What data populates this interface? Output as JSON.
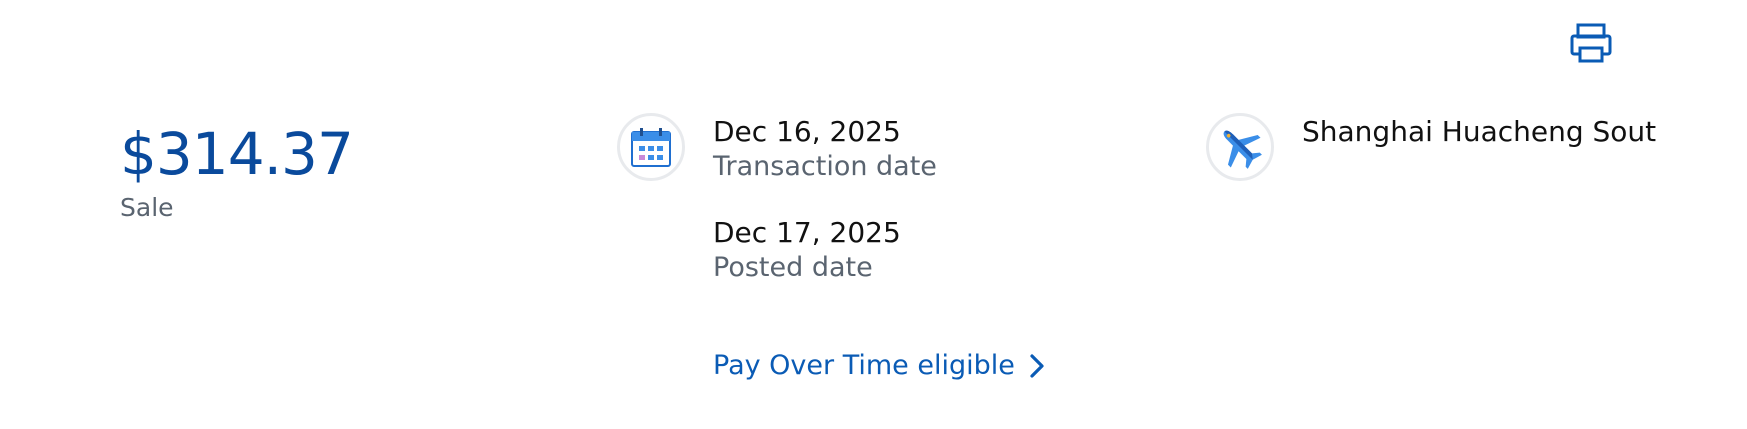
{
  "toolbar": {
    "print_icon": "printer-icon"
  },
  "transaction": {
    "amount": "$314.37",
    "type": "Sale"
  },
  "dates": {
    "transaction_date": "Dec 16, 2025",
    "transaction_label": "Transaction date",
    "posted_date": "Dec 17, 2025",
    "posted_label": "Posted date",
    "icon": "calendar-icon"
  },
  "merchant": {
    "name": "Shanghai Huacheng Sout",
    "icon": "airplane-icon"
  },
  "pay_over_time": {
    "label": "Pay Over Time eligible",
    "icon": "chevron-right-icon"
  },
  "colors": {
    "accent": "#0a5bb5",
    "amount": "#0a4a9c",
    "muted_text": "#5a6470"
  }
}
